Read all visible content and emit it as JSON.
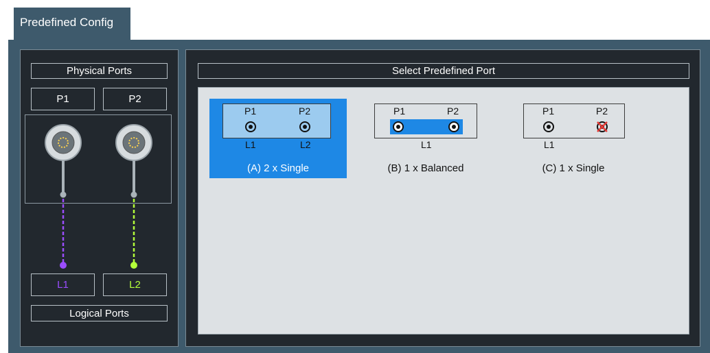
{
  "tab": {
    "label": "Predefined Config"
  },
  "left": {
    "physical_ports_title": "Physical Ports",
    "physical_ports": [
      "P1",
      "P2"
    ],
    "logical_ports": [
      "L1",
      "L2"
    ],
    "logical_ports_title": "Logical Ports",
    "colors": {
      "l1": "#9b4dff",
      "l2": "#b3ff3a"
    }
  },
  "right": {
    "title": "Select Predefined Port",
    "options": [
      {
        "id": "A",
        "caption": "(A) 2 x Single",
        "selected": true,
        "ports": [
          "P1",
          "P2"
        ],
        "logical": [
          "L1",
          "L2"
        ]
      },
      {
        "id": "B",
        "caption": "(B) 1 x Balanced",
        "selected": false,
        "ports": [
          "P1",
          "P2"
        ],
        "logical": [
          "L1"
        ]
      },
      {
        "id": "C",
        "caption": "(C) 1 x Single",
        "selected": false,
        "ports": [
          "P1",
          "P2"
        ],
        "logical": [
          "L1"
        ]
      }
    ],
    "selected_color": "#1e88e5"
  }
}
